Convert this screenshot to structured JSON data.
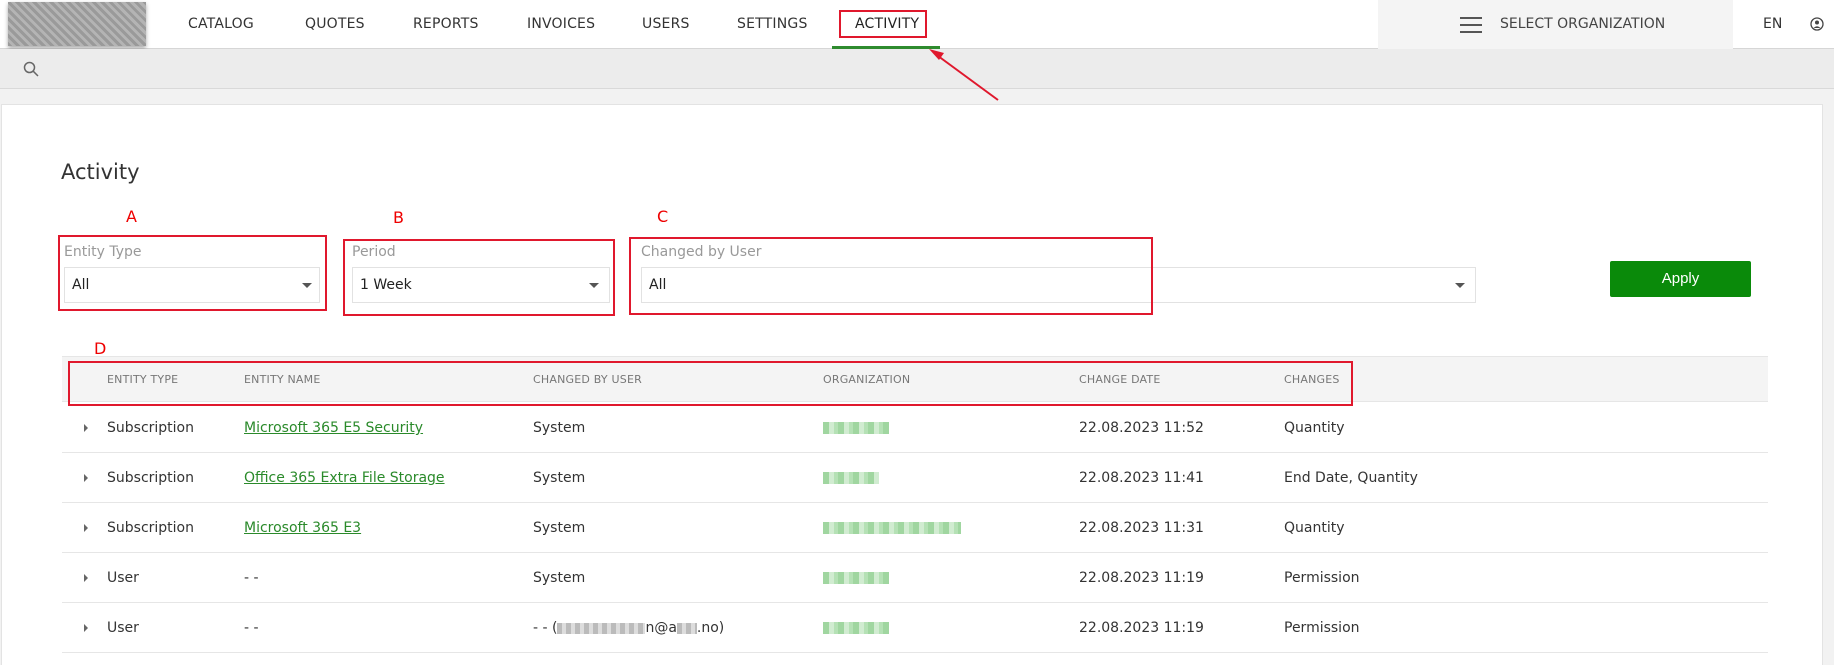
{
  "nav": {
    "items": [
      "CATALOG",
      "QUOTES",
      "REPORTS",
      "INVOICES",
      "USERS",
      "SETTINGS",
      "ACTIVITY"
    ],
    "active": "ACTIVITY",
    "select_org": "SELECT ORGANIZATION",
    "lang": "EN"
  },
  "page": {
    "title": "Activity"
  },
  "annotations": {
    "a": "A",
    "b": "B",
    "c": "C",
    "d": "D"
  },
  "filters": {
    "entity_type": {
      "label": "Entity Type",
      "value": "All"
    },
    "period": {
      "label": "Period",
      "value": "1 Week"
    },
    "changed_by": {
      "label": "Changed by User",
      "value": "All"
    },
    "apply": "Apply"
  },
  "table": {
    "headers": [
      "ENTITY TYPE",
      "ENTITY NAME",
      "CHANGED BY USER",
      "ORGANIZATION",
      "CHANGE DATE",
      "CHANGES"
    ],
    "rows": [
      {
        "entity_type": "Subscription",
        "entity_name": "Microsoft 365 E5 Security",
        "changed_by": "System",
        "change_date": "22.08.2023 11:52",
        "changes": "Quantity"
      },
      {
        "entity_type": "Subscription",
        "entity_name": "Office 365 Extra File Storage",
        "changed_by": "System",
        "change_date": "22.08.2023 11:41",
        "changes": "End Date, Quantity"
      },
      {
        "entity_type": "Subscription",
        "entity_name": "Microsoft 365 E3",
        "changed_by": "System",
        "change_date": "22.08.2023 11:31",
        "changes": "Quantity"
      },
      {
        "entity_type": "User",
        "entity_name": "- -",
        "changed_by": "System",
        "change_date": "22.08.2023 11:19",
        "changes": "Permission"
      },
      {
        "entity_type": "User",
        "entity_name": "- -",
        "changed_by": "- - (",
        "changed_by_suffix": "n@a",
        "changed_by_end": ".no)",
        "change_date": "22.08.2023 11:19",
        "changes": "Permission"
      }
    ]
  },
  "colors": {
    "accent": "#0a8a0a",
    "link": "#2a8a2a",
    "annotation": "#e0182d"
  }
}
